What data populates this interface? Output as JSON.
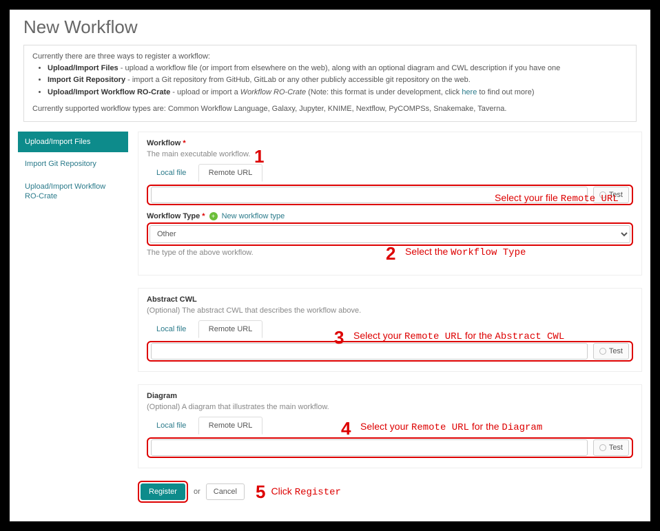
{
  "page_title": "New Workflow",
  "info": {
    "intro": "Currently there are three ways to register a workflow:",
    "bullets": [
      {
        "b": "Upload/Import Files",
        "rest": " - upload a workflow file (or import from elsewhere on the web), along with an optional diagram and CWL description if you have one"
      },
      {
        "b": "Import Git Repository",
        "rest": " - import a Git repository from GitHub, GitLab or any other publicly accessible git repository on the web."
      },
      {
        "b": "Upload/Import Workflow RO-Crate",
        "rest_pre": " - upload or import a ",
        "em": "Workflow RO-Crate",
        "rest_mid": " (Note: this format is under development, click ",
        "link": "here",
        "rest_post": " to find out more)"
      }
    ],
    "supported": "Currently supported workflow types are: Common Workflow Language, Galaxy, Jupyter, KNIME, Nextflow, PyCOMPSs, Snakemake, Taverna."
  },
  "sidebar": {
    "items": [
      {
        "label": "Upload/Import Files",
        "active": true
      },
      {
        "label": "Import Git Repository",
        "active": false
      },
      {
        "label": "Upload/Import Workflow RO-Crate",
        "active": false
      }
    ]
  },
  "workflow": {
    "label": "Workflow",
    "desc": "The main executable workflow.",
    "tab_local": "Local file",
    "tab_remote": "Remote URL",
    "test": "Test",
    "type_label": "Workflow Type",
    "new_type": "New workflow type",
    "type_selected": "Other",
    "type_desc": "The type of the above workflow."
  },
  "cwl": {
    "label": "Abstract CWL",
    "desc": "(Optional) The abstract CWL that describes the workflow above.",
    "tab_local": "Local file",
    "tab_remote": "Remote URL",
    "test": "Test"
  },
  "diagram": {
    "label": "Diagram",
    "desc": "(Optional) A diagram that illustrates the main workflow.",
    "tab_local": "Local file",
    "tab_remote": "Remote URL",
    "test": "Test"
  },
  "actions": {
    "register": "Register",
    "or": "or",
    "cancel": "Cancel"
  },
  "annotations": {
    "n1": "1",
    "a1_pre": "Select your file ",
    "a1_mono": "Remote URL",
    "n2": "2",
    "a2_pre": "Select the ",
    "a2_mono": "Workflow Type",
    "n3": "3",
    "a3_pre": "Select your ",
    "a3_mono1": "Remote URL",
    "a3_mid": " for the ",
    "a3_mono2": "Abstract CWL",
    "n4": "4",
    "a4_pre": "Select your ",
    "a4_mono1": "Remote URL",
    "a4_mid": " for the ",
    "a4_mono2": "Diagram",
    "n5": "5",
    "a5_pre": "Click ",
    "a5_mono": "Register"
  }
}
